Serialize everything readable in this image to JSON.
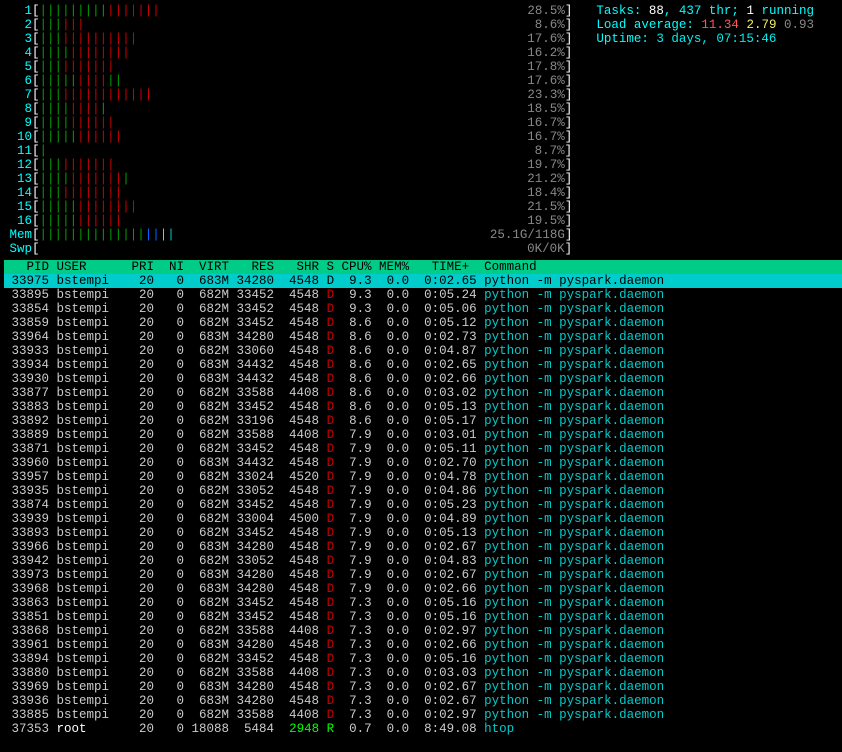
{
  "cpus": [
    {
      "n": "1",
      "bars": "gggggggggrrrrrrr",
      "pct": "28.5%"
    },
    {
      "n": "2",
      "bars": "gggrrr",
      "pct": "8.6%"
    },
    {
      "n": "3",
      "bars": "gggrrrrrrrrrr",
      "pct": "17.6%"
    },
    {
      "n": "4",
      "bars": "ggggrrrrrrrr",
      "pct": "16.2%"
    },
    {
      "n": "5",
      "bars": "gggrrrrrrr",
      "pct": "17.8%"
    },
    {
      "n": "6",
      "bars": "gggggrrrrgg",
      "pct": "17.6%"
    },
    {
      "n": "7",
      "bars": "gggrrrrrrrrrrrr",
      "pct": "23.3%"
    },
    {
      "n": "8",
      "bars": "ggggrrrrg",
      "pct": "18.5%"
    },
    {
      "n": "9",
      "bars": "ggggrrrrrr",
      "pct": "16.7%"
    },
    {
      "n": "10",
      "bars": "gggggrrrrrr",
      "pct": "16.7%"
    },
    {
      "n": "11",
      "bars": "g",
      "pct": "8.7%"
    },
    {
      "n": "12",
      "bars": "gggrrrrrrr",
      "pct": "19.7%"
    },
    {
      "n": "13",
      "bars": "ggggrrrrrrrg",
      "pct": "21.2%"
    },
    {
      "n": "14",
      "bars": "gggrrrrrrrr",
      "pct": "18.4%"
    },
    {
      "n": "15",
      "bars": "gggggrrrrrrrr",
      "pct": "21.5%"
    },
    {
      "n": "16",
      "bars": "gggggrrrrrr",
      "pct": "19.5%"
    }
  ],
  "mem": {
    "bars": "ggggggggggggggbbyc",
    "pct": "25.1G/118G"
  },
  "swp": {
    "bars": "",
    "pct": "0K/0K"
  },
  "tasks_label": "Tasks: ",
  "tasks": "88",
  "thr": ", 437 thr; ",
  "running_lbl": "1",
  "running_txt": " running",
  "load_label": "Load average: ",
  "load1": "11.34",
  "load2": "2.79",
  "load3": "0.93",
  "uptime_label": "Uptime: ",
  "uptime": "3 days, 07:15:46",
  "columns": [
    "  PID",
    "USER",
    "PRI",
    " NI",
    " VIRT",
    "  RES",
    "  SHR",
    "S",
    "CPU%",
    "MEM%",
    "  TIME+ ",
    "Command"
  ],
  "procs": [
    {
      "pid": "33975",
      "user": "bstempi",
      "pri": "20",
      "ni": "0",
      "virt": "683M",
      "res": "34280",
      "shr": "4548",
      "s": "D",
      "cpu": "9.3",
      "mem": "0.0",
      "time": "0:02.65",
      "cmd": "python -m pyspark.daemon",
      "sel": true
    },
    {
      "pid": "33895",
      "user": "bstempi",
      "pri": "20",
      "ni": "0",
      "virt": "682M",
      "res": "33452",
      "shr": "4548",
      "s": "D",
      "cpu": "9.3",
      "mem": "0.0",
      "time": "0:05.24",
      "cmd": "python -m pyspark.daemon"
    },
    {
      "pid": "33854",
      "user": "bstempi",
      "pri": "20",
      "ni": "0",
      "virt": "682M",
      "res": "33452",
      "shr": "4548",
      "s": "D",
      "cpu": "9.3",
      "mem": "0.0",
      "time": "0:05.06",
      "cmd": "python -m pyspark.daemon"
    },
    {
      "pid": "33859",
      "user": "bstempi",
      "pri": "20",
      "ni": "0",
      "virt": "682M",
      "res": "33452",
      "shr": "4548",
      "s": "D",
      "cpu": "8.6",
      "mem": "0.0",
      "time": "0:05.12",
      "cmd": "python -m pyspark.daemon"
    },
    {
      "pid": "33964",
      "user": "bstempi",
      "pri": "20",
      "ni": "0",
      "virt": "683M",
      "res": "34280",
      "shr": "4548",
      "s": "D",
      "cpu": "8.6",
      "mem": "0.0",
      "time": "0:02.73",
      "cmd": "python -m pyspark.daemon"
    },
    {
      "pid": "33933",
      "user": "bstempi",
      "pri": "20",
      "ni": "0",
      "virt": "682M",
      "res": "33060",
      "shr": "4548",
      "s": "D",
      "cpu": "8.6",
      "mem": "0.0",
      "time": "0:04.87",
      "cmd": "python -m pyspark.daemon"
    },
    {
      "pid": "33934",
      "user": "bstempi",
      "pri": "20",
      "ni": "0",
      "virt": "683M",
      "res": "34432",
      "shr": "4548",
      "s": "D",
      "cpu": "8.6",
      "mem": "0.0",
      "time": "0:02.65",
      "cmd": "python -m pyspark.daemon"
    },
    {
      "pid": "33930",
      "user": "bstempi",
      "pri": "20",
      "ni": "0",
      "virt": "683M",
      "res": "34432",
      "shr": "4548",
      "s": "D",
      "cpu": "8.6",
      "mem": "0.0",
      "time": "0:02.66",
      "cmd": "python -m pyspark.daemon"
    },
    {
      "pid": "33877",
      "user": "bstempi",
      "pri": "20",
      "ni": "0",
      "virt": "682M",
      "res": "33588",
      "shr": "4408",
      "s": "D",
      "cpu": "8.6",
      "mem": "0.0",
      "time": "0:03.02",
      "cmd": "python -m pyspark.daemon"
    },
    {
      "pid": "33883",
      "user": "bstempi",
      "pri": "20",
      "ni": "0",
      "virt": "682M",
      "res": "33452",
      "shr": "4548",
      "s": "D",
      "cpu": "8.6",
      "mem": "0.0",
      "time": "0:05.13",
      "cmd": "python -m pyspark.daemon"
    },
    {
      "pid": "33892",
      "user": "bstempi",
      "pri": "20",
      "ni": "0",
      "virt": "682M",
      "res": "33196",
      "shr": "4548",
      "s": "D",
      "cpu": "8.6",
      "mem": "0.0",
      "time": "0:05.17",
      "cmd": "python -m pyspark.daemon"
    },
    {
      "pid": "33889",
      "user": "bstempi",
      "pri": "20",
      "ni": "0",
      "virt": "682M",
      "res": "33588",
      "shr": "4408",
      "s": "D",
      "cpu": "7.9",
      "mem": "0.0",
      "time": "0:03.01",
      "cmd": "python -m pyspark.daemon"
    },
    {
      "pid": "33871",
      "user": "bstempi",
      "pri": "20",
      "ni": "0",
      "virt": "682M",
      "res": "33452",
      "shr": "4548",
      "s": "D",
      "cpu": "7.9",
      "mem": "0.0",
      "time": "0:05.11",
      "cmd": "python -m pyspark.daemon"
    },
    {
      "pid": "33960",
      "user": "bstempi",
      "pri": "20",
      "ni": "0",
      "virt": "683M",
      "res": "34432",
      "shr": "4548",
      "s": "D",
      "cpu": "7.9",
      "mem": "0.0",
      "time": "0:02.70",
      "cmd": "python -m pyspark.daemon"
    },
    {
      "pid": "33957",
      "user": "bstempi",
      "pri": "20",
      "ni": "0",
      "virt": "682M",
      "res": "33024",
      "shr": "4520",
      "s": "D",
      "cpu": "7.9",
      "mem": "0.0",
      "time": "0:04.78",
      "cmd": "python -m pyspark.daemon"
    },
    {
      "pid": "33935",
      "user": "bstempi",
      "pri": "20",
      "ni": "0",
      "virt": "682M",
      "res": "33052",
      "shr": "4548",
      "s": "D",
      "cpu": "7.9",
      "mem": "0.0",
      "time": "0:04.86",
      "cmd": "python -m pyspark.daemon"
    },
    {
      "pid": "33874",
      "user": "bstempi",
      "pri": "20",
      "ni": "0",
      "virt": "682M",
      "res": "33452",
      "shr": "4548",
      "s": "D",
      "cpu": "7.9",
      "mem": "0.0",
      "time": "0:05.23",
      "cmd": "python -m pyspark.daemon"
    },
    {
      "pid": "33939",
      "user": "bstempi",
      "pri": "20",
      "ni": "0",
      "virt": "682M",
      "res": "33004",
      "shr": "4500",
      "s": "D",
      "cpu": "7.9",
      "mem": "0.0",
      "time": "0:04.89",
      "cmd": "python -m pyspark.daemon"
    },
    {
      "pid": "33893",
      "user": "bstempi",
      "pri": "20",
      "ni": "0",
      "virt": "682M",
      "res": "33452",
      "shr": "4548",
      "s": "D",
      "cpu": "7.9",
      "mem": "0.0",
      "time": "0:05.13",
      "cmd": "python -m pyspark.daemon"
    },
    {
      "pid": "33966",
      "user": "bstempi",
      "pri": "20",
      "ni": "0",
      "virt": "683M",
      "res": "34280",
      "shr": "4548",
      "s": "D",
      "cpu": "7.9",
      "mem": "0.0",
      "time": "0:02.67",
      "cmd": "python -m pyspark.daemon"
    },
    {
      "pid": "33942",
      "user": "bstempi",
      "pri": "20",
      "ni": "0",
      "virt": "682M",
      "res": "33052",
      "shr": "4548",
      "s": "D",
      "cpu": "7.9",
      "mem": "0.0",
      "time": "0:04.83",
      "cmd": "python -m pyspark.daemon"
    },
    {
      "pid": "33973",
      "user": "bstempi",
      "pri": "20",
      "ni": "0",
      "virt": "683M",
      "res": "34280",
      "shr": "4548",
      "s": "D",
      "cpu": "7.9",
      "mem": "0.0",
      "time": "0:02.67",
      "cmd": "python -m pyspark.daemon"
    },
    {
      "pid": "33968",
      "user": "bstempi",
      "pri": "20",
      "ni": "0",
      "virt": "683M",
      "res": "34280",
      "shr": "4548",
      "s": "D",
      "cpu": "7.9",
      "mem": "0.0",
      "time": "0:02.66",
      "cmd": "python -m pyspark.daemon"
    },
    {
      "pid": "33863",
      "user": "bstempi",
      "pri": "20",
      "ni": "0",
      "virt": "682M",
      "res": "33452",
      "shr": "4548",
      "s": "D",
      "cpu": "7.3",
      "mem": "0.0",
      "time": "0:05.16",
      "cmd": "python -m pyspark.daemon"
    },
    {
      "pid": "33851",
      "user": "bstempi",
      "pri": "20",
      "ni": "0",
      "virt": "682M",
      "res": "33452",
      "shr": "4548",
      "s": "D",
      "cpu": "7.3",
      "mem": "0.0",
      "time": "0:05.16",
      "cmd": "python -m pyspark.daemon"
    },
    {
      "pid": "33868",
      "user": "bstempi",
      "pri": "20",
      "ni": "0",
      "virt": "682M",
      "res": "33588",
      "shr": "4408",
      "s": "D",
      "cpu": "7.3",
      "mem": "0.0",
      "time": "0:02.97",
      "cmd": "python -m pyspark.daemon"
    },
    {
      "pid": "33961",
      "user": "bstempi",
      "pri": "20",
      "ni": "0",
      "virt": "683M",
      "res": "34280",
      "shr": "4548",
      "s": "D",
      "cpu": "7.3",
      "mem": "0.0",
      "time": "0:02.66",
      "cmd": "python -m pyspark.daemon"
    },
    {
      "pid": "33894",
      "user": "bstempi",
      "pri": "20",
      "ni": "0",
      "virt": "682M",
      "res": "33452",
      "shr": "4548",
      "s": "D",
      "cpu": "7.3",
      "mem": "0.0",
      "time": "0:05.16",
      "cmd": "python -m pyspark.daemon"
    },
    {
      "pid": "33880",
      "user": "bstempi",
      "pri": "20",
      "ni": "0",
      "virt": "682M",
      "res": "33588",
      "shr": "4408",
      "s": "D",
      "cpu": "7.3",
      "mem": "0.0",
      "time": "0:03.03",
      "cmd": "python -m pyspark.daemon"
    },
    {
      "pid": "33969",
      "user": "bstempi",
      "pri": "20",
      "ni": "0",
      "virt": "683M",
      "res": "34280",
      "shr": "4548",
      "s": "D",
      "cpu": "7.3",
      "mem": "0.0",
      "time": "0:02.67",
      "cmd": "python -m pyspark.daemon"
    },
    {
      "pid": "33936",
      "user": "bstempi",
      "pri": "20",
      "ni": "0",
      "virt": "683M",
      "res": "34280",
      "shr": "4548",
      "s": "D",
      "cpu": "7.3",
      "mem": "0.0",
      "time": "0:02.67",
      "cmd": "python -m pyspark.daemon"
    },
    {
      "pid": "33885",
      "user": "bstempi",
      "pri": "20",
      "ni": "0",
      "virt": "682M",
      "res": "33588",
      "shr": "4408",
      "s": "D",
      "cpu": "7.3",
      "mem": "0.0",
      "time": "0:02.97",
      "cmd": "python -m pyspark.daemon"
    },
    {
      "pid": "37353",
      "user": "root",
      "pri": "20",
      "ni": "0",
      "virt": "18088",
      "res": "5484",
      "shr": "2948",
      "s": "R",
      "cpu": "0.7",
      "mem": "0.0",
      "time": "8:49.08",
      "cmd": "htop",
      "root": true
    }
  ]
}
